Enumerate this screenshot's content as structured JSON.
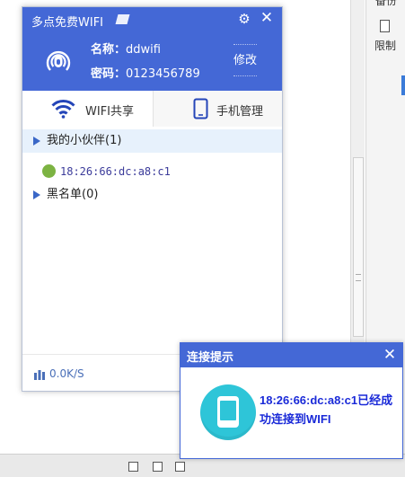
{
  "background": {
    "right_panel": {
      "backup_label": "备份",
      "limit_label": "限制"
    }
  },
  "popup": {
    "title": "多点免费WIFI",
    "header": {
      "name_key": "名称：",
      "name_value": "ddwifi",
      "password_key": "密码：",
      "password_value": "0123456789",
      "modify_label": "修改"
    },
    "tabs": [
      {
        "label": "WIFI共享",
        "icon": "wifi-icon",
        "active": true
      },
      {
        "label": "手机管理",
        "icon": "phone-icon",
        "active": false
      }
    ],
    "groups": {
      "partners": {
        "label": "我的小伙伴(1)"
      },
      "device": {
        "label": "18:26:66:dc:a8:c1",
        "icon": "android-icon"
      },
      "blacklist": {
        "label": "黑名单(0)"
      }
    },
    "footer": {
      "speed": "0.0K/S"
    },
    "colors": {
      "accent": "#4468d6"
    }
  },
  "notification": {
    "title": "连接提示",
    "message": "18:26:66:dc:a8:c1已经成功连接到WIFI",
    "icon": "tablet-icon",
    "colors": {
      "message": "#1a2ad8",
      "icon_bg": "#2ec5d8"
    }
  }
}
